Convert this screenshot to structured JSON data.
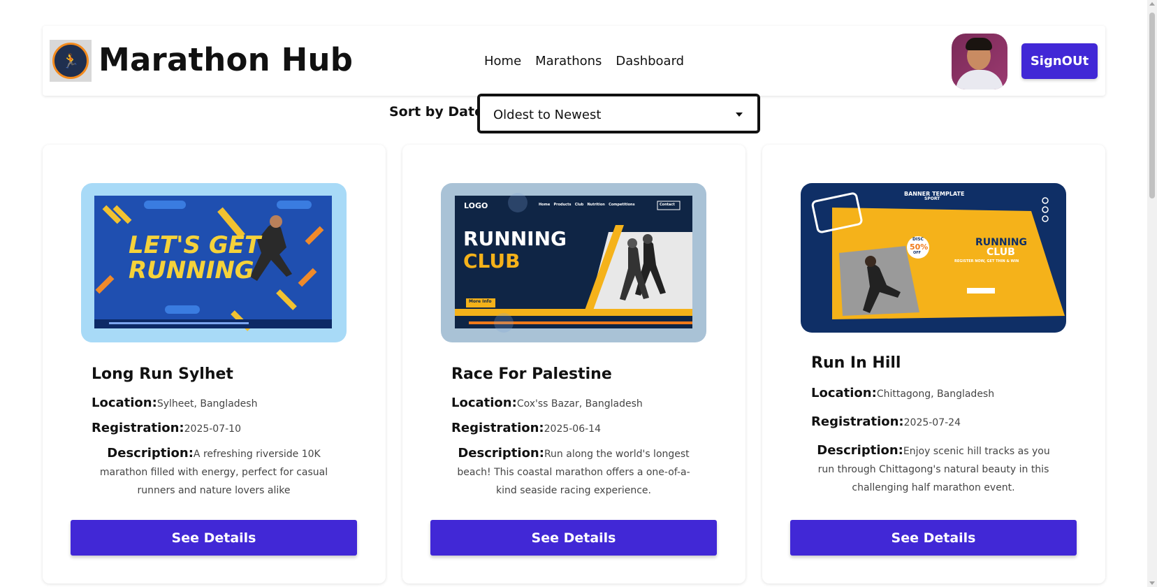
{
  "brand": {
    "name": "Marathon Hub",
    "logo_icon": "running-man-logo"
  },
  "nav": {
    "home": "Home",
    "marathons": "Marathons",
    "dashboard": "Dashboard"
  },
  "user": {
    "signout_label": "SignOUt"
  },
  "sort": {
    "label": "Sort by Date:",
    "value": "Oldest to Newest"
  },
  "labels": {
    "location": "Location:",
    "registration": "Registration:",
    "description": "Description:",
    "details_button": "See Details"
  },
  "cards": [
    {
      "title": "Long Run Sylhet",
      "location": "Sylheet, Bangladesh",
      "registration": "2025-07-10",
      "description": "A refreshing riverside 10K marathon filled with energy, perfect for casual runners and nature lovers alike",
      "image_text": {
        "line1": "LET'S GET",
        "line2": "RUNNING"
      },
      "colors": {
        "frame": "#a8daf7",
        "bg": "#1f4fb0"
      }
    },
    {
      "title": "Race For Palestine",
      "location": "Cox'ss Bazar, Bangladesh",
      "registration": "2025-06-14",
      "description": "Run along the world's longest beach! This coastal marathon offers a one-of-a-kind seaside racing experience.",
      "image_text": {
        "logo": "LOGO",
        "line1": "RUNNING",
        "line2": "CLUB",
        "nav": "Home   Products   Club   Nutrition   Competitions",
        "contact": "Contact",
        "more": "More Info"
      },
      "colors": {
        "frame": "#a9c2d6",
        "bg": "#0f2545"
      }
    },
    {
      "title": "Run In Hill",
      "location": "Chittagong, Bangladesh",
      "registration": "2025-07-24",
      "description": "Enjoy scenic hill tracks as you run through Chittagong's natural beauty in this challenging half marathon event.",
      "image_text": {
        "banner": "BANNER TEMPLATE",
        "sport": "SPORT",
        "line1": "RUNNING",
        "line2": "CLUB",
        "disc": "DISC",
        "pct": "50%",
        "off": "OFF",
        "register": "REGISTER NOW, GET THIN & WIN"
      },
      "colors": {
        "frame": "#0f2f66",
        "bg": "#f5b21a"
      }
    }
  ]
}
